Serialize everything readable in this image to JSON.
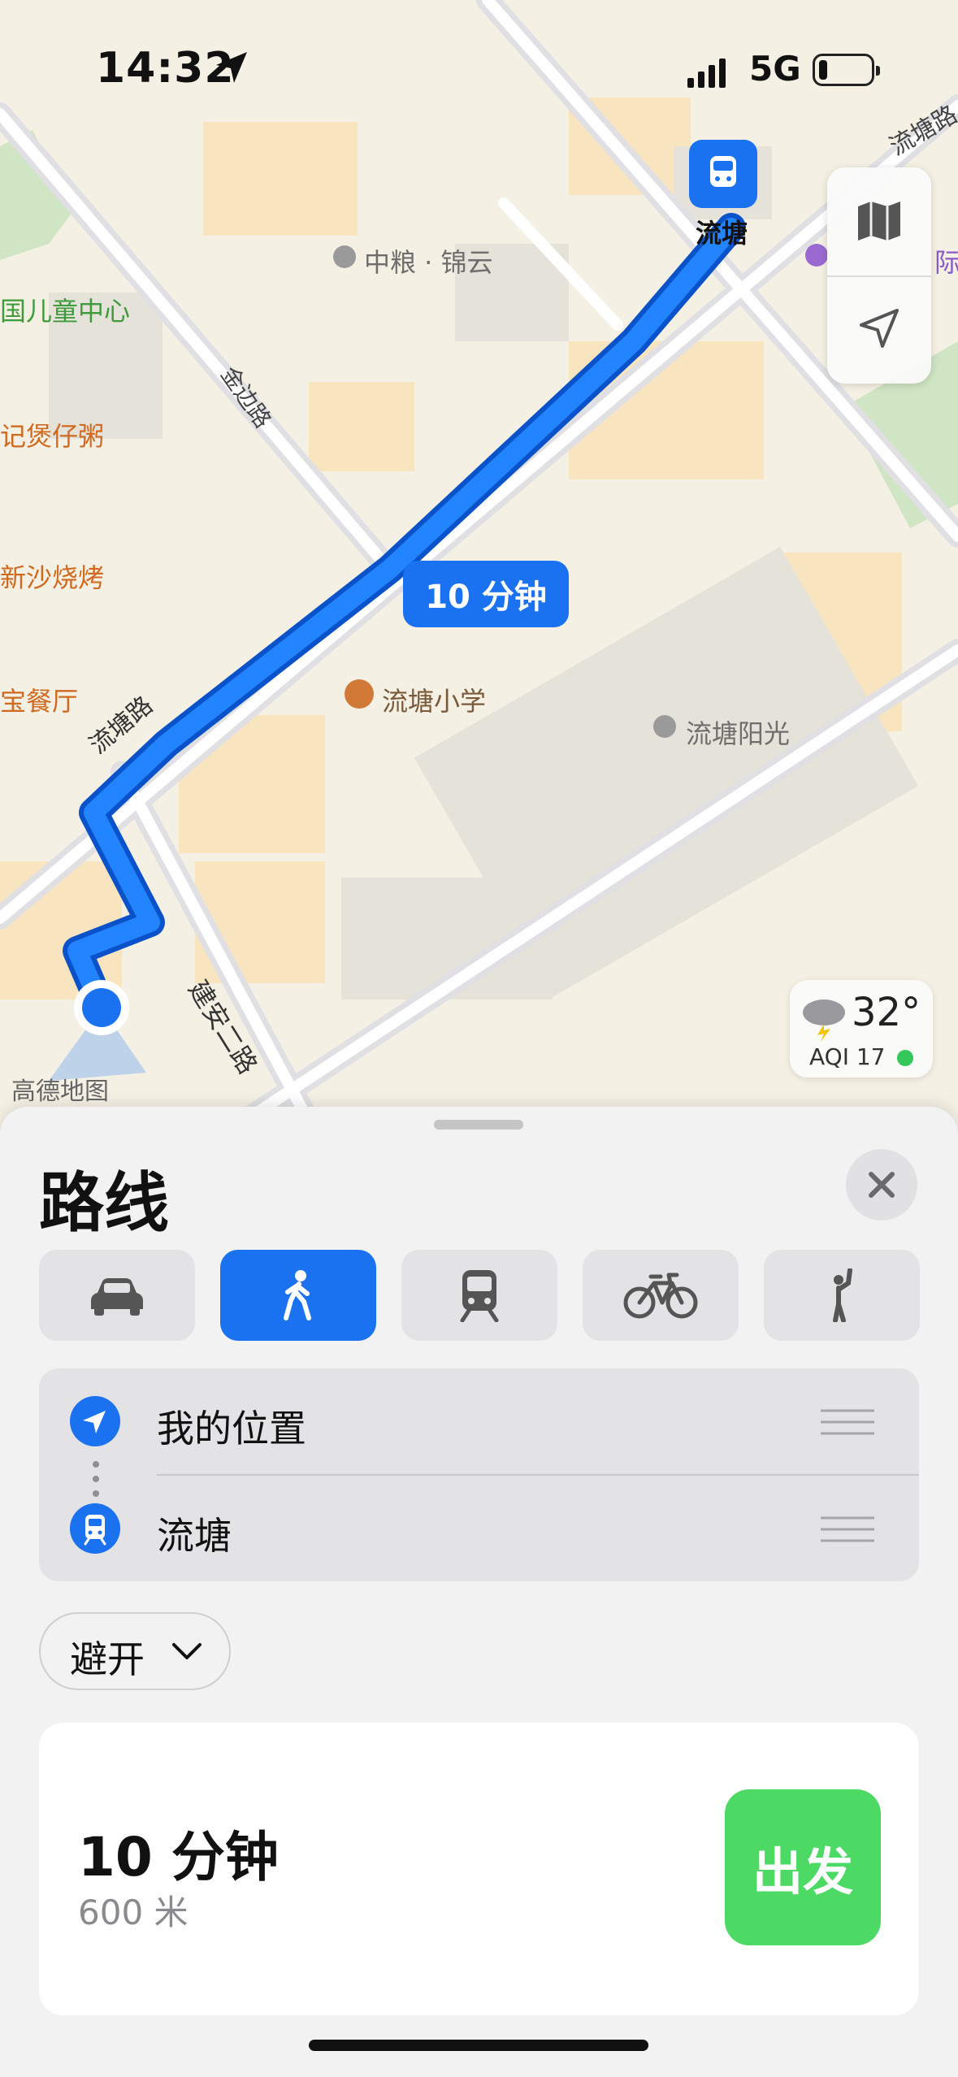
{
  "status_bar": {
    "time": "14:32",
    "network": "5G"
  },
  "map": {
    "eta_bubble": "10 分钟",
    "destination_pin_label": "流塘",
    "labels": {
      "zhongliang": "中粮 · 锦云",
      "children_center": "国儿童中心",
      "jinbian_rd": "金边路",
      "congee": "记煲仔粥",
      "bbq": "新沙烧烤",
      "restaurant": "宝餐厅",
      "liutang_rd": "流塘路",
      "school": "流塘小学",
      "yangguang": "流塘阳光",
      "jianan_rd": "建安二路",
      "liutang_top": "流塘路",
      "partial_right": "际",
      "provider": "高德地图"
    },
    "weather": {
      "temp": "32°",
      "aqi": "AQI 17"
    }
  },
  "sheet": {
    "title": "路线",
    "modes": [
      {
        "name": "drive",
        "icon": "car-icon"
      },
      {
        "name": "walk",
        "icon": "walking-icon",
        "active": true
      },
      {
        "name": "transit",
        "icon": "train-icon"
      },
      {
        "name": "cycle",
        "icon": "bicycle-icon"
      },
      {
        "name": "rideshare",
        "icon": "hail-person-icon"
      }
    ],
    "route": {
      "start": "我的位置",
      "end": "流塘"
    },
    "avoid_label": "避开",
    "result": {
      "duration": "10 分钟",
      "distance": "600 米",
      "go_label": "出发"
    }
  },
  "colors": {
    "accent": "#1a72f0",
    "go": "#4cd964",
    "map_bg": "#f4efe3"
  }
}
